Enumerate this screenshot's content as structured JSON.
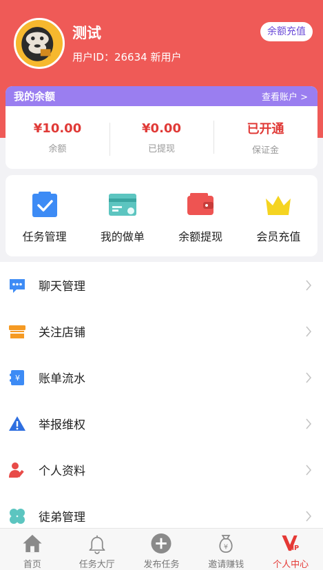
{
  "header": {
    "username": "测试",
    "user_id_line": "用户ID：26634 新用户",
    "recharge_button": "余额充值"
  },
  "balance": {
    "title": "我的余额",
    "link": "查看账户 >",
    "items": [
      {
        "value": "¥10.00",
        "label": "余额"
      },
      {
        "value": "¥0.00",
        "label": "已提现"
      },
      {
        "value": "已开通",
        "label": "保证金"
      }
    ]
  },
  "quick": [
    {
      "label": "任务管理",
      "icon": "task-icon",
      "color": "#3d8bf5"
    },
    {
      "label": "我的做单",
      "icon": "card-icon",
      "color": "#5cc5c0"
    },
    {
      "label": "余额提现",
      "icon": "wallet-icon",
      "color": "#ee5452"
    },
    {
      "label": "会员充值",
      "icon": "crown-icon",
      "color": "#f5d421"
    }
  ],
  "menu": [
    {
      "label": "聊天管理",
      "icon": "chat-icon"
    },
    {
      "label": "关注店铺",
      "icon": "store-icon"
    },
    {
      "label": "账单流水",
      "icon": "bill-icon"
    },
    {
      "label": "举报维权",
      "icon": "warning-icon"
    },
    {
      "label": "个人资料",
      "icon": "profile-icon"
    },
    {
      "label": "徒弟管理",
      "icon": "clover-icon"
    }
  ],
  "tabs": [
    {
      "label": "首页",
      "icon": "home-icon"
    },
    {
      "label": "任务大厅",
      "icon": "bell-icon"
    },
    {
      "label": "发布任务",
      "icon": "plus-icon"
    },
    {
      "label": "邀请赚钱",
      "icon": "money-bag-icon"
    },
    {
      "label": "个人中心",
      "icon": "vip-icon",
      "active": true
    }
  ],
  "colors": {
    "header": "#ef5a57",
    "balance_head": "#9a7ef0",
    "accent_red": "#e03a37"
  }
}
